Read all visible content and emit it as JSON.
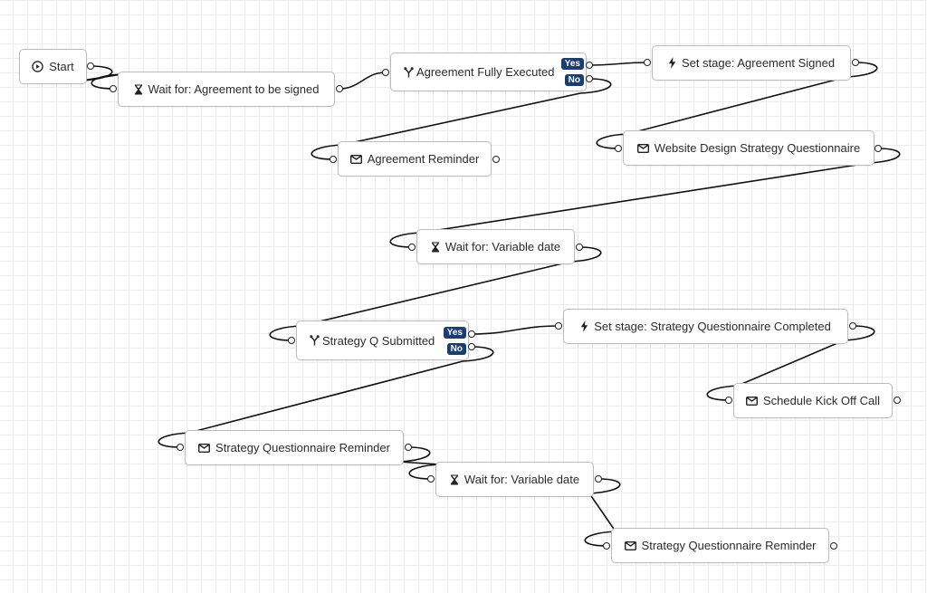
{
  "canvas": {
    "grid": true,
    "edge_color": "#111111",
    "badge_color": "#1c3d6e"
  },
  "nodes": [
    {
      "id": "start",
      "type": "start",
      "icon": "play-circle-icon",
      "label": "Start"
    },
    {
      "id": "wait-agreement",
      "type": "wait",
      "icon": "hourglass-icon",
      "label": "Wait for: Agreement to be signed"
    },
    {
      "id": "cond-agreement",
      "type": "condition",
      "icon": "branch-icon",
      "label": "Agreement Fully Executed",
      "branches": [
        "Yes",
        "No"
      ]
    },
    {
      "id": "stage-agreement",
      "type": "set-stage",
      "icon": "lightning-icon",
      "label": "Set stage: Agreement Signed"
    },
    {
      "id": "email-agreement-reminder",
      "type": "email",
      "icon": "envelope-icon",
      "label": "Agreement Reminder"
    },
    {
      "id": "email-questionnaire",
      "type": "email",
      "icon": "envelope-icon",
      "label": "Website Design Strategy Questionnaire"
    },
    {
      "id": "wait-date-1",
      "type": "wait",
      "icon": "hourglass-icon",
      "label": "Wait for: Variable date"
    },
    {
      "id": "cond-strategy",
      "type": "condition",
      "icon": "branch-icon",
      "label": "Strategy Q Submitted",
      "branches": [
        "Yes",
        "No"
      ]
    },
    {
      "id": "stage-strategy",
      "type": "set-stage",
      "icon": "lightning-icon",
      "label": "Set stage: Strategy Questionnaire Completed"
    },
    {
      "id": "email-kickoff",
      "type": "email",
      "icon": "envelope-icon",
      "label": "Schedule Kick Off Call"
    },
    {
      "id": "email-strategy-reminder-1",
      "type": "email",
      "icon": "envelope-icon",
      "label": "Strategy Questionnaire Reminder"
    },
    {
      "id": "wait-date-2",
      "type": "wait",
      "icon": "hourglass-icon",
      "label": "Wait for: Variable date"
    },
    {
      "id": "email-strategy-reminder-2",
      "type": "email",
      "icon": "envelope-icon",
      "label": "Strategy Questionnaire Reminder"
    }
  ],
  "edges": [
    {
      "from": "start",
      "to": "wait-agreement"
    },
    {
      "from": "wait-agreement",
      "to": "cond-agreement"
    },
    {
      "from": "cond-agreement",
      "branch": "Yes",
      "to": "stage-agreement"
    },
    {
      "from": "cond-agreement",
      "branch": "No",
      "to": "email-agreement-reminder"
    },
    {
      "from": "stage-agreement",
      "to": "email-questionnaire"
    },
    {
      "from": "email-questionnaire",
      "to": "wait-date-1"
    },
    {
      "from": "wait-date-1",
      "to": "cond-strategy"
    },
    {
      "from": "cond-strategy",
      "branch": "Yes",
      "to": "stage-strategy"
    },
    {
      "from": "cond-strategy",
      "branch": "No",
      "to": "email-strategy-reminder-1"
    },
    {
      "from": "stage-strategy",
      "to": "email-kickoff"
    },
    {
      "from": "email-strategy-reminder-1",
      "to": "wait-date-2"
    },
    {
      "from": "wait-date-2",
      "to": "email-strategy-reminder-2"
    }
  ]
}
